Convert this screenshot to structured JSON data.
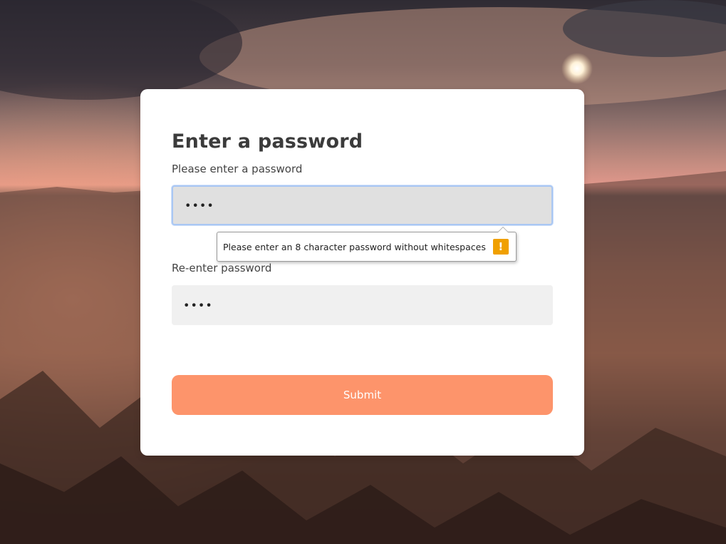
{
  "form": {
    "title": "Enter a password",
    "password_label": "Please enter a password",
    "password_value": "••••",
    "confirm_label": "Re-enter password",
    "confirm_value": "••••",
    "submit_label": "Submit"
  },
  "tooltip": {
    "message": "Please enter an 8 character password without whitespaces",
    "icon_symbol": "!"
  },
  "colors": {
    "submit": "#fd946b",
    "warning": "#f0a000",
    "focus_border": "#a9c7f3"
  }
}
